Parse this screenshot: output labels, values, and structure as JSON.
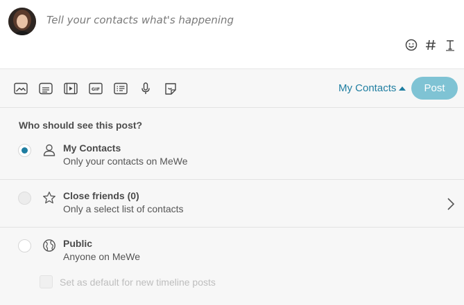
{
  "composer": {
    "placeholder": "Tell your contacts what's happening",
    "icons": [
      "emoji-icon",
      "hashtag-icon",
      "text-format-icon"
    ]
  },
  "toolbar": {
    "media_icons": [
      "photo-icon",
      "document-icon",
      "video-icon",
      "gif-icon",
      "poll-icon",
      "microphone-icon",
      "sticker-icon"
    ],
    "audience_label": "My Contacts",
    "post_label": "Post"
  },
  "panel": {
    "title": "Who should see this post?",
    "options": [
      {
        "title": "My Contacts",
        "description": "Only your contacts on MeWe",
        "selected": true,
        "icon": "person-icon"
      },
      {
        "title": "Close friends (0)",
        "description": "Only a select list of contacts",
        "selected": false,
        "icon": "star-icon"
      },
      {
        "title": "Public",
        "description": "Anyone on MeWe",
        "selected": false,
        "icon": "globe-icon"
      }
    ],
    "default_label": "Set as default for new timeline posts"
  },
  "colors": {
    "accent": "#1f7ea1",
    "post_button": "#7fc3d4"
  }
}
